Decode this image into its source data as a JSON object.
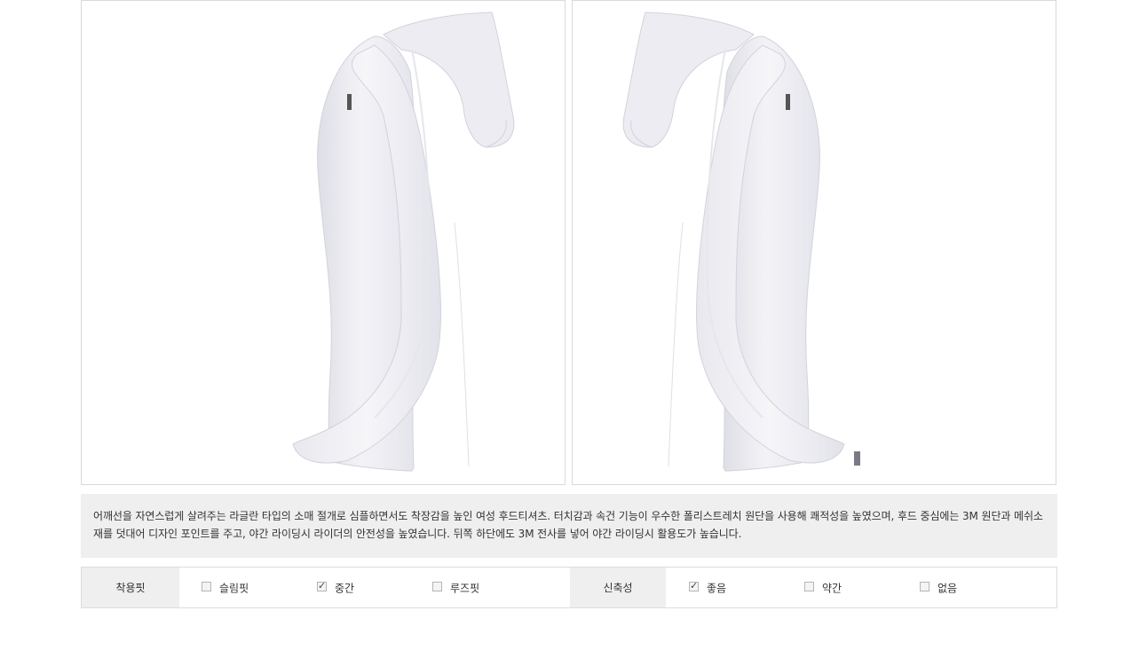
{
  "description": "어깨선을 자연스럽게 살려주는 라글란 타입의 소매 절개로 심플하면서도 착장감을 높인 여성 후드티셔츠. 터치감과 속건 기능이 우수한 폴리스트레치 원단을 사용해 쾌적성을 높였으며, 후드 중심에는 3M 원단과 메쉬소재를 덧대어 디자인 포인트를 주고, 야간 라이딩시 라이더의 안전성을 높였습니다. 뒤쪽 하단에도 3M 전사를 넣어 야간 라이딩시 활용도가 높습니다.",
  "fit": {
    "label": "착용핏",
    "options": [
      {
        "label": "슬림핏",
        "checked": false
      },
      {
        "label": "중간",
        "checked": true
      },
      {
        "label": "루즈핏",
        "checked": false
      }
    ]
  },
  "stretch": {
    "label": "신축성",
    "options": [
      {
        "label": "좋음",
        "checked": true
      },
      {
        "label": "약간",
        "checked": false
      },
      {
        "label": "없음",
        "checked": false
      }
    ]
  },
  "colors": {
    "garment": "#f0f0f5",
    "garment_shadow": "#dcdce4",
    "panel_bg": "#efefef",
    "border": "#d9d9d9"
  }
}
